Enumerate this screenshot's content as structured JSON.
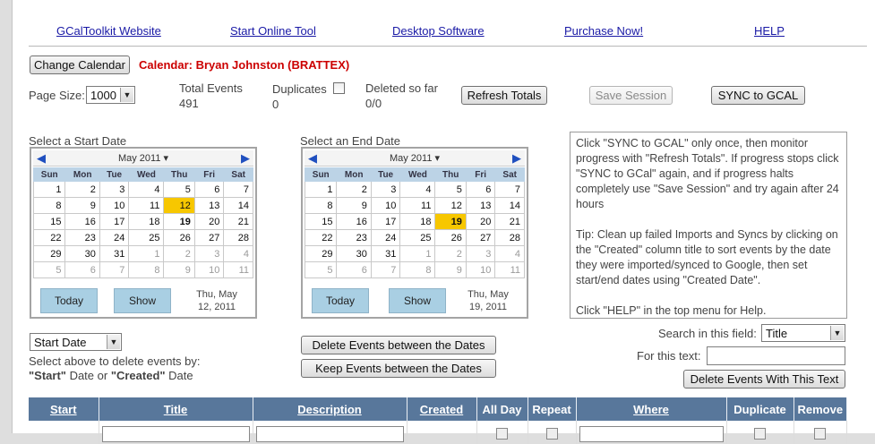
{
  "nav": {
    "website": "GCalToolkit Website",
    "online_tool": "Start Online Tool",
    "desktop": "Desktop Software",
    "purchase": "Purchase Now!",
    "help": "HELP"
  },
  "calendar_bar": {
    "change_button": "Change Calendar",
    "calendar_label": "Calendar: Bryan Johnston (BRATTEX)"
  },
  "stats": {
    "page_size_label": "Page Size:",
    "page_size_value": "1000",
    "total_events_label": "Total Events",
    "total_events_value": "491",
    "duplicates_label": "Duplicates",
    "duplicates_value": "0",
    "deleted_label": "Deleted so far",
    "deleted_value": "0/0",
    "refresh_button": "Refresh Totals",
    "save_button": "Save Session",
    "sync_button": "SYNC to GCAL"
  },
  "start_cal": {
    "label": "Select a Start Date",
    "month": "May 2011",
    "weekdays": [
      "Sun",
      "Mon",
      "Tue",
      "Wed",
      "Thu",
      "Fri",
      "Sat"
    ],
    "weeks": [
      [
        "1",
        "2",
        "3",
        "4",
        "5",
        "6",
        "7"
      ],
      [
        "8",
        "9",
        "10",
        "11",
        "12",
        "13",
        "14"
      ],
      [
        "15",
        "16",
        "17",
        "18",
        "19",
        "20",
        "21"
      ],
      [
        "22",
        "23",
        "24",
        "25",
        "26",
        "27",
        "28"
      ],
      [
        "29",
        "30",
        "31",
        "1",
        "2",
        "3",
        "4"
      ],
      [
        "5",
        "6",
        "7",
        "8",
        "9",
        "10",
        "11"
      ]
    ],
    "today_button": "Today",
    "show_button": "Show",
    "selected_text": "Thu, May\n12, 2011"
  },
  "end_cal": {
    "label": "Select an End Date",
    "month": "May 2011",
    "weekdays": [
      "Sun",
      "Mon",
      "Tue",
      "Wed",
      "Thu",
      "Fri",
      "Sat"
    ],
    "weeks": [
      [
        "1",
        "2",
        "3",
        "4",
        "5",
        "6",
        "7"
      ],
      [
        "8",
        "9",
        "10",
        "11",
        "12",
        "13",
        "14"
      ],
      [
        "15",
        "16",
        "17",
        "18",
        "19",
        "20",
        "21"
      ],
      [
        "22",
        "23",
        "24",
        "25",
        "26",
        "27",
        "28"
      ],
      [
        "29",
        "30",
        "31",
        "1",
        "2",
        "3",
        "4"
      ],
      [
        "5",
        "6",
        "7",
        "8",
        "9",
        "10",
        "11"
      ]
    ],
    "today_button": "Today",
    "show_button": "Show",
    "selected_text": "Thu, May\n19, 2011"
  },
  "info": {
    "text": "Click \"SYNC to GCAL\" only once, then monitor progress with \"Refresh Totals\". If progress stops click \"SYNC to GCal\" again, and if progress halts completely use \"Save Session\" and try again after 24 hours\n\nTip: Clean up failed Imports and Syncs by clicking on the \"Created\" column title to sort events by the date they were imported/synced to Google, then set start/end dates using \"Created Date\".\n\nClick \"HELP\" in the top menu for Help."
  },
  "date_type": {
    "value": "Start Date",
    "hint_line1": "Select above to delete events by:",
    "hint_start": "\"Start\"",
    "hint_mid": " Date or ",
    "hint_created": "\"Created\"",
    "hint_end": " Date"
  },
  "actions": {
    "delete_between": "Delete Events between the Dates",
    "keep_between": "Keep Events between the Dates"
  },
  "search": {
    "field_label": "Search in this field:",
    "field_value": "Title",
    "text_label": "For this text:",
    "delete_button": "Delete Events With This Text"
  },
  "table": {
    "columns": [
      "Start",
      "Title",
      "Description",
      "Created",
      "All Day",
      "Repeat",
      "Where",
      "Duplicate",
      "Remove"
    ],
    "rows": [
      {
        "start": "",
        "title": "",
        "description": "",
        "created": "",
        "where": ""
      }
    ]
  },
  "colors": {
    "calendar_label": "#cc0000",
    "selected_day": "#f7c700",
    "table_header": "#58779b",
    "link": "#1a1aa6"
  }
}
